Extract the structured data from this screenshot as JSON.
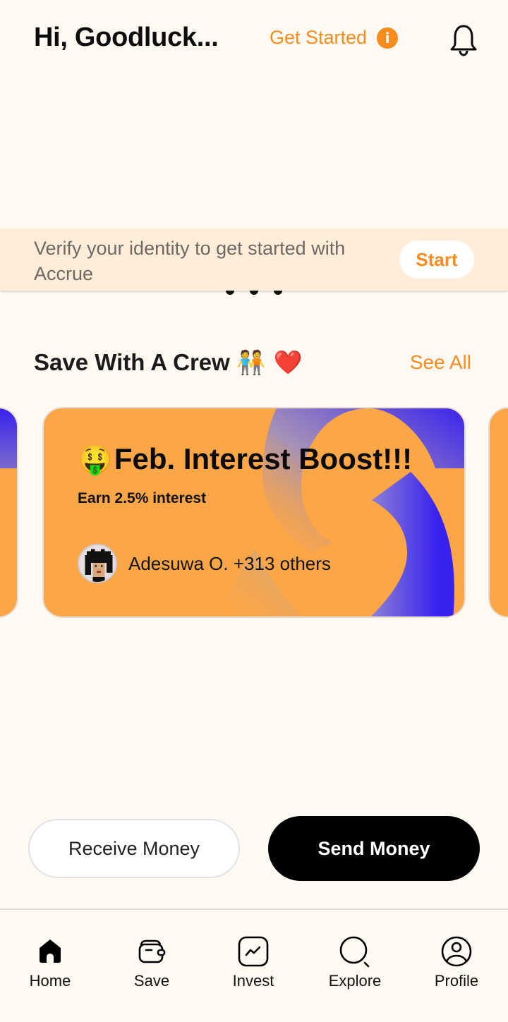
{
  "header": {
    "greeting": "Hi, Goodluck...",
    "get_started_label": "Get Started",
    "info_icon": "i"
  },
  "verify_banner": {
    "text": "Verify your identity to get started with Accrue",
    "button_label": "Start"
  },
  "carousel_dots": {
    "count": 3,
    "active_index": 2
  },
  "crew_section": {
    "title": "Save With A Crew",
    "title_emoji": "🧑‍🤝‍🧑 ❤️",
    "see_all_label": "See All",
    "cards": [
      {
        "emoji": "🤑",
        "title": "Feb. Interest Boost!!!",
        "subtitle": "Earn 2.5% interest",
        "members_text": "Adesuwa O. +313 others"
      }
    ]
  },
  "actions": {
    "receive_label": "Receive Money",
    "send_label": "Send Money"
  },
  "tabbar": {
    "items": [
      {
        "label": "Home",
        "icon": "home-icon",
        "active": true
      },
      {
        "label": "Save",
        "icon": "wallet-icon",
        "active": false
      },
      {
        "label": "Invest",
        "icon": "chart-icon",
        "active": false
      },
      {
        "label": "Explore",
        "icon": "search-icon",
        "active": false
      },
      {
        "label": "Profile",
        "icon": "profile-icon",
        "active": false
      }
    ]
  },
  "colors": {
    "background": "#FFF9F3",
    "accent": "#F68B1E",
    "card_orange": "#FBA647",
    "card_blue": "#3A22EE",
    "banner_bg": "#FFEDD9"
  }
}
